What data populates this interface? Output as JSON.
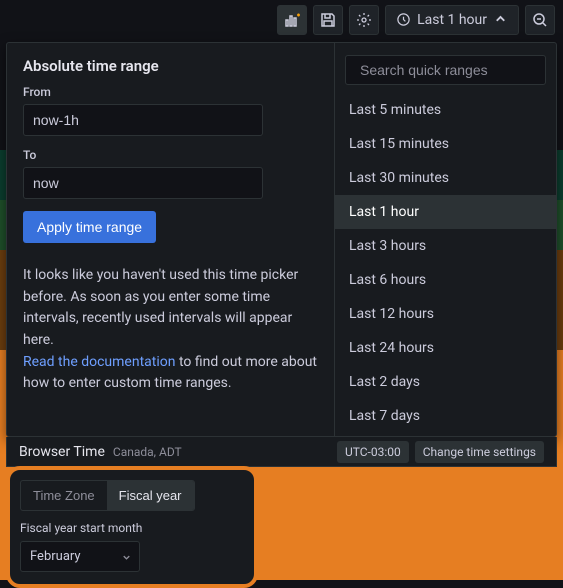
{
  "toolbar": {
    "current_range": "Last 1 hour"
  },
  "timepicker": {
    "heading": "Absolute time range",
    "from_label": "From",
    "from_value": "now-1h",
    "to_label": "To",
    "to_value": "now",
    "apply_label": "Apply time range",
    "helper_text1": "It looks like you haven't used this time picker before. As soon as you enter some time intervals, recently used intervals will appear here.",
    "helper_link": "Read the documentation",
    "helper_text2": " to find out more about how to enter custom time ranges."
  },
  "quick_ranges": {
    "search_placeholder": "Search quick ranges",
    "items": [
      {
        "label": "Last 5 minutes"
      },
      {
        "label": "Last 15 minutes"
      },
      {
        "label": "Last 30 minutes"
      },
      {
        "label": "Last 1 hour"
      },
      {
        "label": "Last 3 hours"
      },
      {
        "label": "Last 6 hours"
      },
      {
        "label": "Last 12 hours"
      },
      {
        "label": "Last 24 hours"
      },
      {
        "label": "Last 2 days"
      },
      {
        "label": "Last 7 days"
      }
    ],
    "selected_index": 3
  },
  "footer": {
    "browser_time": "Browser Time",
    "tz_sub": "Canada, ADT",
    "utc_offset": "UTC-03:00",
    "change_settings": "Change time settings"
  },
  "fiscal": {
    "tabs": {
      "timezone": "Time Zone",
      "fiscal": "Fiscal year"
    },
    "active_tab": "fiscal",
    "label": "Fiscal year start month",
    "selected": "February"
  }
}
